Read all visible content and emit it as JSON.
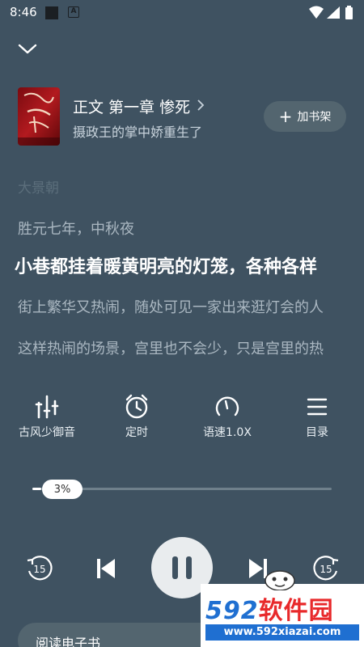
{
  "status_bar": {
    "time": "8:46",
    "a_icon": "A"
  },
  "book": {
    "chapter_title": "正文 第一章 惨死",
    "book_name": "摄政王的掌中娇重生了",
    "cover_icon": "book-cover-image",
    "add_shelf_label": "加书架"
  },
  "text_lines": [
    "大景朝",
    "胜元七年，中秋夜",
    "小巷都挂着暖黄明亮的灯笼，各种各样",
    "街上繁华又热闹，随处可见一家出来逛灯会的人",
    "这样热闹的场景，宫里也不会少，只是宫里的热"
  ],
  "controls": [
    {
      "label": "古风少御音",
      "icon": "voice-equalizer-icon"
    },
    {
      "label": "定时",
      "icon": "alarm-clock-icon"
    },
    {
      "label": "语速1.0X",
      "icon": "speed-gauge-icon"
    },
    {
      "label": "目录",
      "icon": "menu-list-icon"
    }
  ],
  "progress": {
    "percent_label": "3%",
    "fraction": 0.03
  },
  "playback": {
    "rewind_label": "15",
    "forward_label": "15"
  },
  "read_ebook_label": "阅读电子书",
  "watermark": {
    "logo_num": "592",
    "logo_cn": "软件园",
    "url": "www.592xiazai.com"
  },
  "colors": {
    "background": "#3f5261",
    "button_bg": "#53656f",
    "play_bg": "#e9ecee",
    "watermark_blue": "#1f6fd1",
    "watermark_red": "#e8292b"
  }
}
